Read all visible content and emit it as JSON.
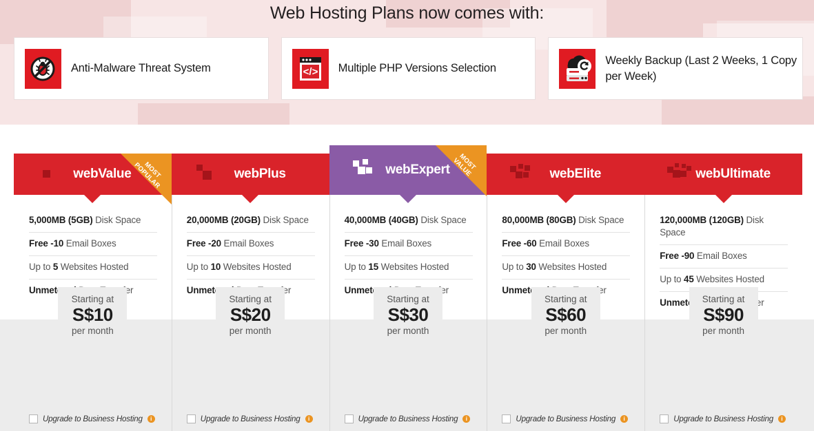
{
  "banner": {
    "title": "Web Hosting Plans now comes with:",
    "features": [
      {
        "icon": "anti-malware-icon",
        "label": "Anti-Malware Threat System"
      },
      {
        "icon": "php-code-icon",
        "label": "Multiple PHP Versions Selection"
      },
      {
        "icon": "cloud-backup-icon",
        "label": "Weekly Backup (Last 2 Weeks, 1 Copy per Week)"
      }
    ]
  },
  "colors": {
    "brand_red": "#d9232a",
    "featured_purple": "#8a5ba6",
    "ribbon_orange": "#eb9422",
    "band_gray": "#ececec",
    "banner_pink": "#f7e5e5"
  },
  "upsell": {
    "label": "Upgrade to Business Hosting",
    "info_icon": "info-icon",
    "checked": false
  },
  "price_labels": {
    "top": "Starting at",
    "bottom": "per month"
  },
  "plans": [
    {
      "name": "webValue",
      "ribbon": "MOST\nPOPULAR",
      "featured": false,
      "squares": 1,
      "disk": {
        "bold": "5,000MB (5GB)",
        "rest": "Disk Space"
      },
      "email": {
        "bold": "Free -10",
        "rest": "Email Boxes"
      },
      "sites": {
        "pre": "Up to ",
        "bold": "5",
        "rest": "Websites Hosted"
      },
      "transfer": {
        "bold": "Unmetered",
        "rest": "Data Transfer"
      },
      "price": "S$10"
    },
    {
      "name": "webPlus",
      "ribbon": "",
      "featured": false,
      "squares": 2,
      "disk": {
        "bold": "20,000MB (20GB)",
        "rest": "Disk Space"
      },
      "email": {
        "bold": "Free -20",
        "rest": "Email Boxes"
      },
      "sites": {
        "pre": "Up to ",
        "bold": "10",
        "rest": "Websites Hosted"
      },
      "transfer": {
        "bold": "Unmetered",
        "rest": "Data Transfer"
      },
      "price": "S$20"
    },
    {
      "name": "webExpert",
      "ribbon": "MOST\nVALUE",
      "featured": true,
      "squares": 4,
      "disk": {
        "bold": "40,000MB (40GB)",
        "rest": "Disk Space"
      },
      "email": {
        "bold": "Free -30",
        "rest": "Email Boxes"
      },
      "sites": {
        "pre": "Up to ",
        "bold": "15",
        "rest": "Websites Hosted"
      },
      "transfer": {
        "bold": "Unmetered",
        "rest": "Data Transfer"
      },
      "price": "S$30"
    },
    {
      "name": "webElite",
      "ribbon": "",
      "featured": false,
      "squares": 5,
      "disk": {
        "bold": "80,000MB (80GB)",
        "rest": "Disk Space"
      },
      "email": {
        "bold": "Free -60",
        "rest": "Email Boxes"
      },
      "sites": {
        "pre": "Up to ",
        "bold": "30",
        "rest": "Websites Hosted"
      },
      "transfer": {
        "bold": "Unmetered",
        "rest": "Data Transfer"
      },
      "price": "S$60"
    },
    {
      "name": "webUltimate",
      "ribbon": "",
      "featured": false,
      "squares": 6,
      "disk": {
        "bold": "120,000MB (120GB)",
        "rest": "Disk Space"
      },
      "email": {
        "bold": "Free -90",
        "rest": "Email Boxes"
      },
      "sites": {
        "pre": "Up to ",
        "bold": "45",
        "rest": "Websites Hosted"
      },
      "transfer": {
        "bold": "Unmetered",
        "rest": "Data Transfer"
      },
      "price": "S$90"
    }
  ]
}
